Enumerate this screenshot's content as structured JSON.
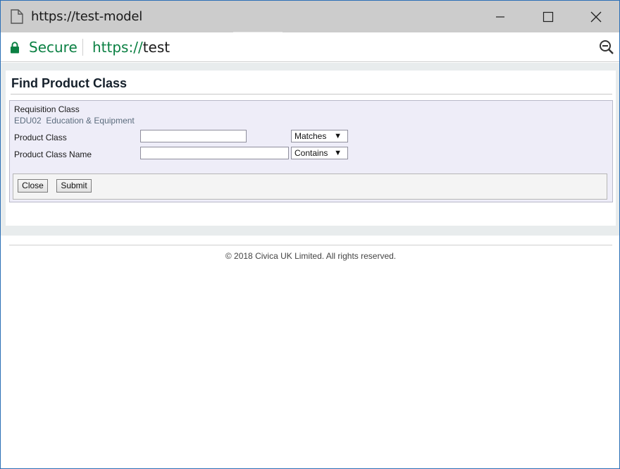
{
  "window": {
    "title": "https://test-model",
    "controls": {
      "minimize": "minimize-icon",
      "maximize": "maximize-icon",
      "close": "close-icon"
    }
  },
  "addressbar": {
    "secure_label": "Secure",
    "url_scheme": "https://",
    "url_host": "test",
    "icons": {
      "lock": "lock-icon",
      "zoom": "zoom-out-icon"
    }
  },
  "page": {
    "title": "Find Product Class",
    "requisition_class_label": "Requisition Class",
    "requisition_class_value": "EDU02  Education & Equipment",
    "fields": [
      {
        "label": "Product Class",
        "value": "",
        "operator": "Matches"
      },
      {
        "label": "Product Class Name",
        "value": "",
        "operator": "Contains"
      }
    ],
    "buttons": {
      "close": "Close",
      "submit": "Submit"
    },
    "dropdown_arrow": "▼"
  },
  "footer": {
    "copyright": "© 2018 Civica UK Limited. All rights reserved."
  },
  "colors": {
    "secure_green": "#0b8043",
    "form_bg": "#eeedf8",
    "titlebar": "#cccccc",
    "window_border": "#2b6fb6"
  }
}
